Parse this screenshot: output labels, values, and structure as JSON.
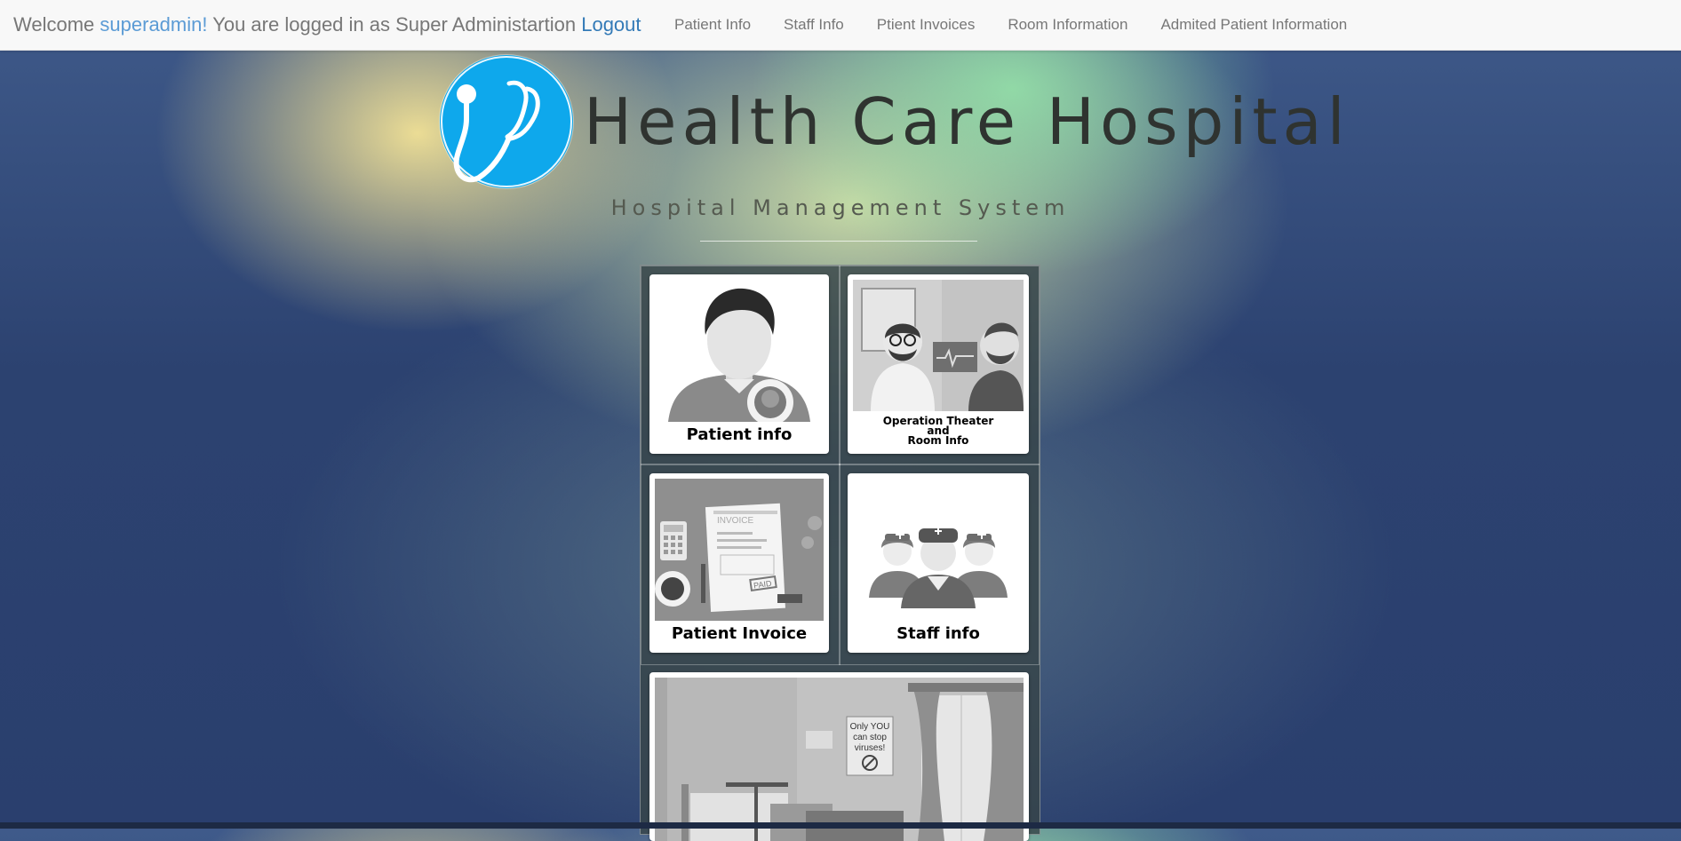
{
  "navbar": {
    "welcome_prefix": "Welcome ",
    "username": "superadmin!",
    "logged_in_text": " You are logged in as Super Administartion ",
    "logout_label": "Logout",
    "links": [
      "Patient Info",
      "Staff Info",
      "Ptient Invoices",
      "Room Information",
      "Admited Patient Information"
    ]
  },
  "header": {
    "title": "Health Care Hospital",
    "subtitle": "Hospital Management System",
    "logo_icon": "stethoscope-icon"
  },
  "tiles": {
    "patient_info": "Patient info",
    "operation_line1": "Operation Theater",
    "operation_line2": "and",
    "operation_line3": "Room Info",
    "patient_invoice": "Patient Invoice",
    "staff_info": "Staff info"
  },
  "illustration_text": {
    "invoice": "INVOICE",
    "paid": "PAID",
    "poster": [
      "Only YOU",
      "can stop",
      "viruses!"
    ]
  },
  "colors": {
    "logo_blue": "#0ea8ec",
    "link_blue": "#337ab7",
    "username_blue": "#5b9bd5"
  }
}
